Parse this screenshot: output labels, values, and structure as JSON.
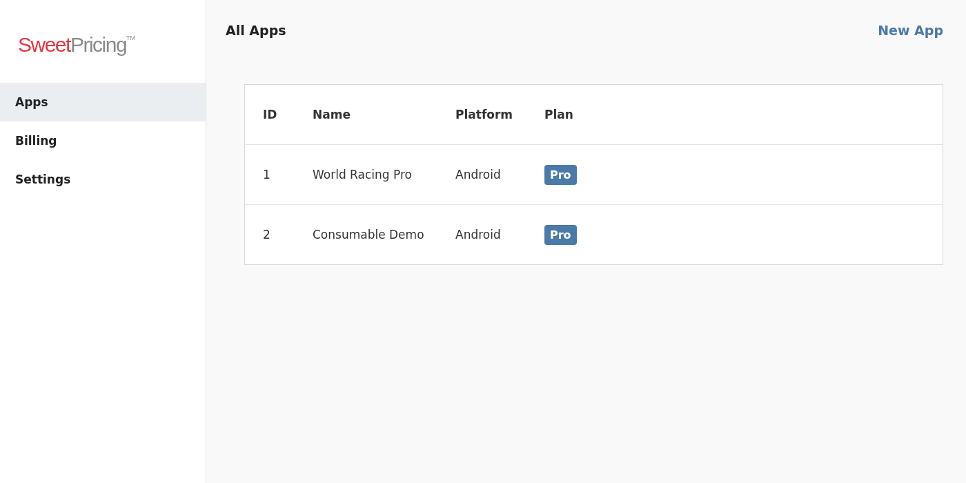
{
  "logo": {
    "part_1": "Sweet",
    "part_2": "Pricing",
    "mark": "TM"
  },
  "sidebar": {
    "items": [
      {
        "label": "Apps",
        "selected": true
      },
      {
        "label": "Billing",
        "selected": false
      },
      {
        "label": "Settings",
        "selected": false
      }
    ]
  },
  "header": {
    "title": "All Apps",
    "action": "New App"
  },
  "table": {
    "columns": [
      "ID",
      "Name",
      "Platform",
      "Plan"
    ],
    "rows": [
      {
        "id": "1",
        "name": "World Racing Pro",
        "platform": "Android",
        "plan": "Pro"
      },
      {
        "id": "2",
        "name": "Consumable Demo",
        "platform": "Android",
        "plan": "Pro"
      }
    ]
  }
}
